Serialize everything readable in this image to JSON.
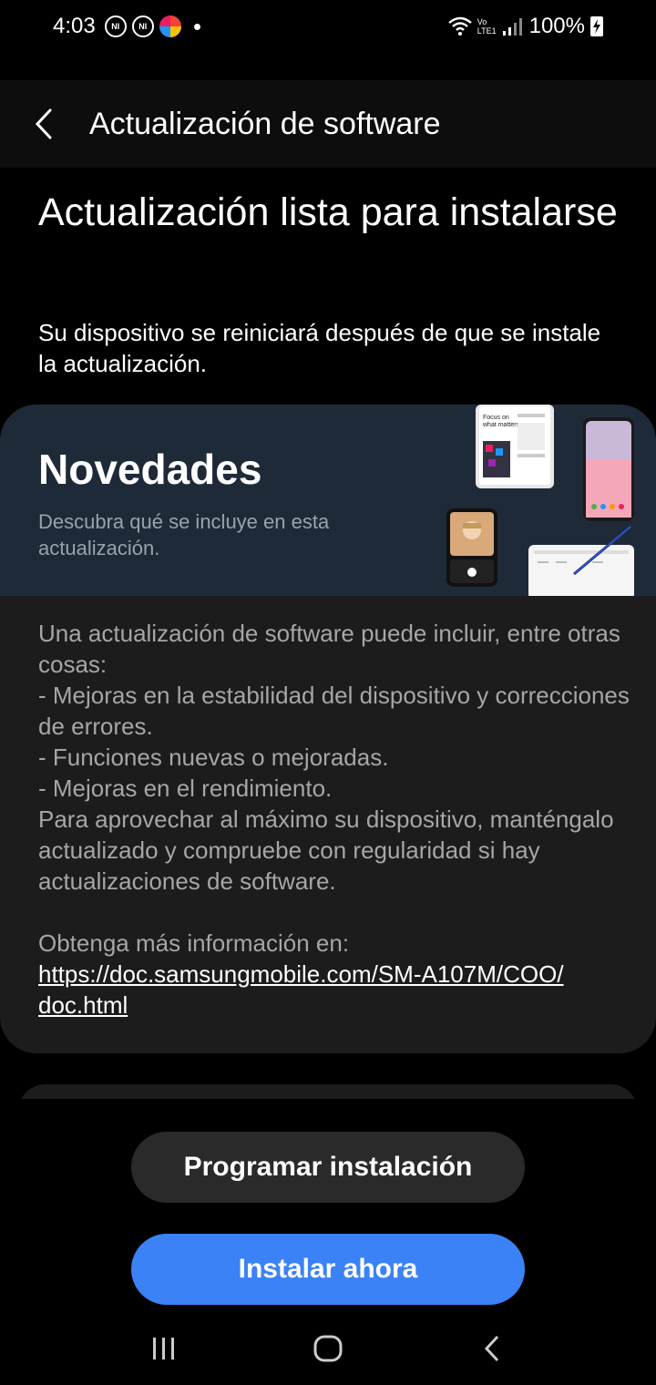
{
  "status_bar": {
    "time": "4:03",
    "notif_label": "NI",
    "volte_top": "Vo",
    "volte_bottom": "LTE1",
    "battery": "100%"
  },
  "app_bar": {
    "title": "Actualización de software"
  },
  "main": {
    "heading": "Actualización lista para instalarse",
    "subtitle": "Su dispositivo se reiniciará después de que se instale la actualización."
  },
  "card": {
    "title": "Novedades",
    "subtitle": "Descubra qué se incluye en esta actualización.",
    "body": "Una actualización de software puede incluir, entre otras cosas:\n - Mejoras en la estabilidad del dispositivo y correcciones de errores.\n - Funciones nuevas o mejoradas.\n - Mejoras en el rendimiento.\nPara aprovechar al máximo su dispositivo, manténgalo actualizado y compruebe con regularidad si hay actualizaciones de software.",
    "more_info_label": "Obtenga más información en:",
    "link": "https://doc.samsungmobile.com/SM-A107M/COO/doc.html",
    "illustration_text": [
      "Focus on",
      "what matters"
    ]
  },
  "buttons": {
    "schedule": "Programar instalación",
    "install": "Instalar ahora"
  },
  "colors": {
    "accent": "#3b82f6",
    "banner_bg": "#1f2a39",
    "card_bg": "#1c1c1c"
  }
}
